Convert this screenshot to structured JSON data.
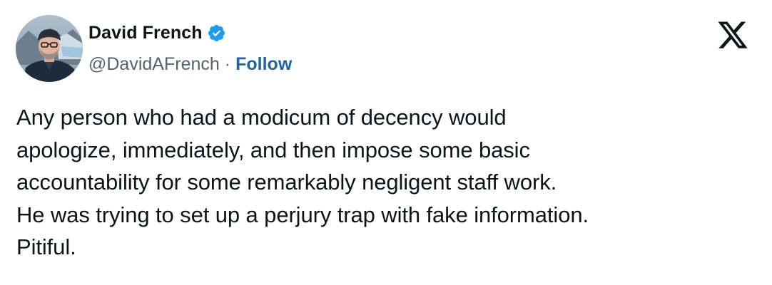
{
  "tweet": {
    "author": {
      "display_name": "David French",
      "handle": "@DavidAFrench",
      "verified": true,
      "avatar_icon": "profile-photo"
    },
    "separator": "·",
    "follow_label": "Follow",
    "text": "Any person who had a modicum of decency would\napologize, immediately, and then impose some basic\naccountability for some remarkably negligent staff work.\nHe was trying to set up a perjury trap with fake information.\nPitiful.",
    "platform_icon": "x-logo-icon"
  },
  "colors": {
    "text": "#0f1419",
    "secondary_text": "#536471",
    "follow_link": "#1d63a8",
    "verified_badge": "#1d9bf0",
    "background": "#ffffff"
  }
}
